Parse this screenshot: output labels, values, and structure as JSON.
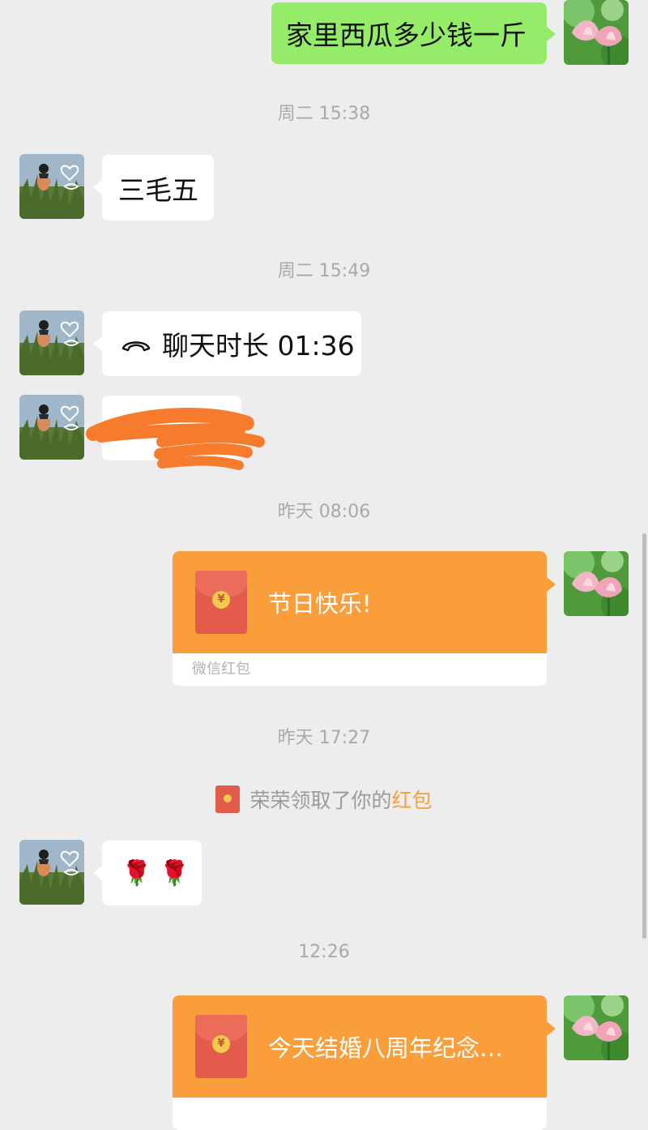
{
  "messages": {
    "m1_text": "家里西瓜多少钱一斤",
    "ts1": "周二 15:38",
    "m2_text": "三毛五",
    "ts2": "周二 15:49",
    "call_icon": "phone-hangup-icon",
    "m3_text": "聊天时长 01:36",
    "ts3": "昨天 08:06",
    "rp1_title": "节日快乐!",
    "rp1_label": "微信红包",
    "ts4": "昨天 17:27",
    "sys_prefix": "荣荣领取了你的",
    "sys_link": "红包",
    "m6_emoji": "🌹 🌹",
    "ts5": "12:26",
    "rp2_title": "今天结婚八周年纪念…"
  },
  "colors": {
    "background": "#ededed",
    "sent_bubble": "#95ec69",
    "received_bubble": "#ffffff",
    "red_packet": "#fa9d3b",
    "link": "#fa9d3b",
    "redaction": "#f77b2c"
  }
}
